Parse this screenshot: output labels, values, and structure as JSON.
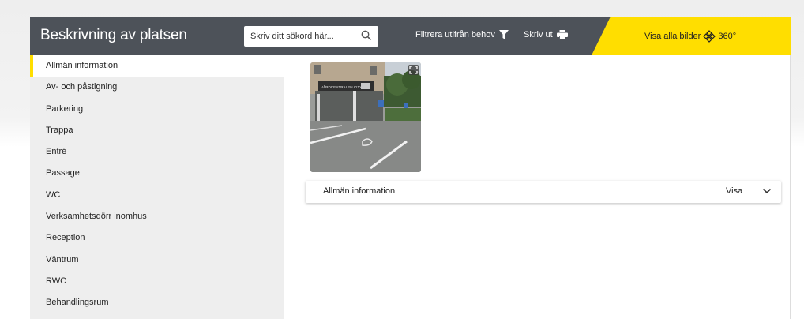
{
  "header": {
    "title": "Beskrivning av platsen",
    "search_placeholder": "Skriv ditt sökord här...",
    "filter_label": "Filtrera utifrån behov",
    "print_label": "Skriv ut",
    "view_all_label": "Visa alla bilder",
    "view_360_label": "360°",
    "colors": {
      "header_bg": "#4d5259",
      "accent": "#ffde00"
    }
  },
  "photo": {
    "sign_text_1": "VÅRDCENTRALEN CITY",
    "sign_text_2": "Vårdcentral"
  },
  "sidebar": {
    "items": [
      {
        "label": "Allmän information",
        "active": true
      },
      {
        "label": "Av- och påstigning"
      },
      {
        "label": "Parkering"
      },
      {
        "label": "Trappa"
      },
      {
        "label": "Entré"
      },
      {
        "label": "Passage"
      },
      {
        "label": "WC"
      },
      {
        "label": "Verksamhetsdörr inomhus"
      },
      {
        "label": "Reception"
      },
      {
        "label": "Väntrum"
      },
      {
        "label": "RWC"
      },
      {
        "label": "Behandlingsrum"
      }
    ]
  },
  "accordion": {
    "label": "Allmän information",
    "toggle_label": "Visa",
    "icon": "chevron-down-icon"
  }
}
